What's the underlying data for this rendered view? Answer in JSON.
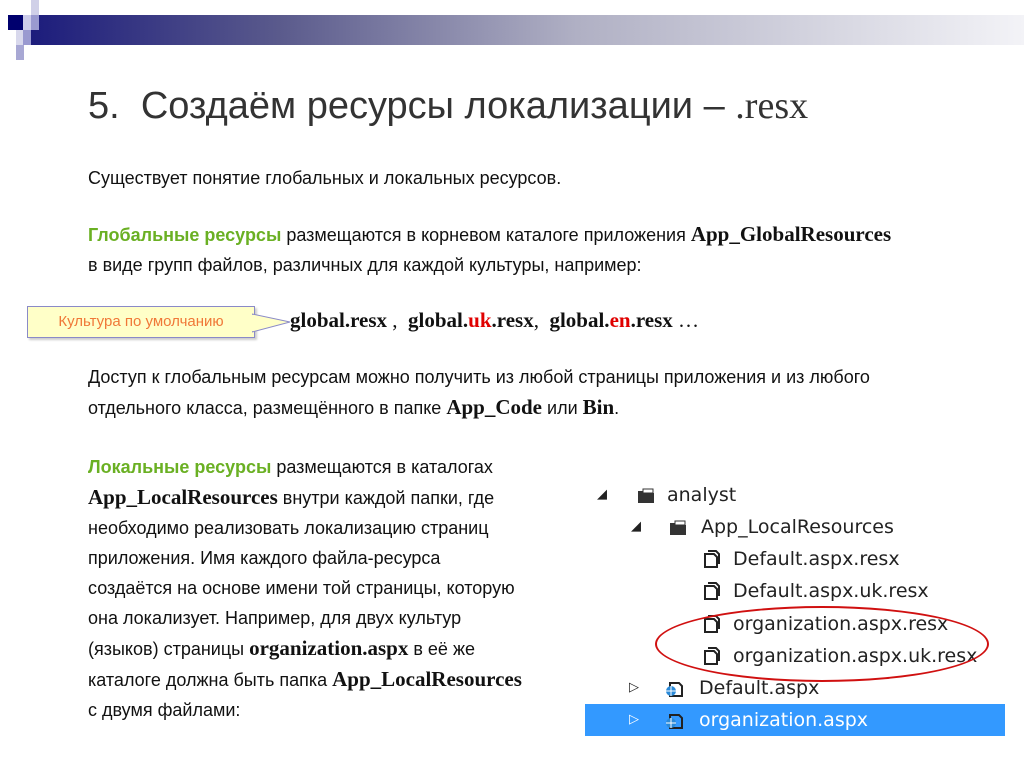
{
  "title": {
    "number": "5.",
    "text": "Создаём ресурсы локализации –",
    "ext": ".resx"
  },
  "intro": "Существует понятие глобальных и локальных ресурсов.",
  "global": {
    "term": "Глобальные ресурсы",
    "text1": " размещаются в корневом каталоге приложения ",
    "folder": "App_GlobalResources",
    "text2": "в виде групп файлов, различных для каждой культуры, например:"
  },
  "callout": "Культура по умолчанию",
  "files": {
    "f1": "global.resx",
    "sep1": " ,  ",
    "f2a": "global.",
    "f2b": "uk",
    "f2c": ".resx",
    "sep2": ",  ",
    "f3a": "global.",
    "f3b": "en",
    "f3c": ".resx",
    "tail": " …"
  },
  "access": {
    "text1": "Доступ к глобальным ресурсам можно получить из любой страницы приложения и из любого",
    "text2": "отдельного класса, размещённого в папке ",
    "code": "App_Code",
    "or": " или ",
    "bin": "Bin",
    "end": "."
  },
  "local": {
    "term": "Локальные ресурсы",
    "l1": " размещаются в каталогах",
    "folder": "App_LocalResources",
    "l2": " внутри каждой папки, где",
    "l3": "необходимо реализовать локализацию страниц",
    "l4": "приложения. Имя каждого файла-ресурса",
    "l5": "создаётся на основе имени той страницы, которую",
    "l6": "она локализует. Например, для двух культур",
    "l7": "(языков) страницы ",
    "page": "organization.aspx",
    "l7b": " в её же",
    "l8": "каталоге должна быть папка ",
    "folder2": "App_LocalResources",
    "l9": "с двумя файлами:"
  },
  "tree": [
    {
      "label": "analyst",
      "icon": "folder-icon"
    },
    {
      "label": "App_LocalResources",
      "icon": "folder-icon"
    },
    {
      "label": "Default.aspx.resx",
      "icon": "file-icon"
    },
    {
      "label": "Default.aspx.uk.resx",
      "icon": "file-icon"
    },
    {
      "label": "organization.aspx.resx",
      "icon": "file-icon"
    },
    {
      "label": "organization.aspx.uk.resx",
      "icon": "file-icon"
    },
    {
      "label": "Default.aspx",
      "icon": "web-page-icon"
    },
    {
      "label": "organization.aspx",
      "icon": "web-page-icon"
    }
  ],
  "colors": {
    "accent": "#6ab023",
    "highlight": "#e00000",
    "selection": "#3399ff"
  }
}
